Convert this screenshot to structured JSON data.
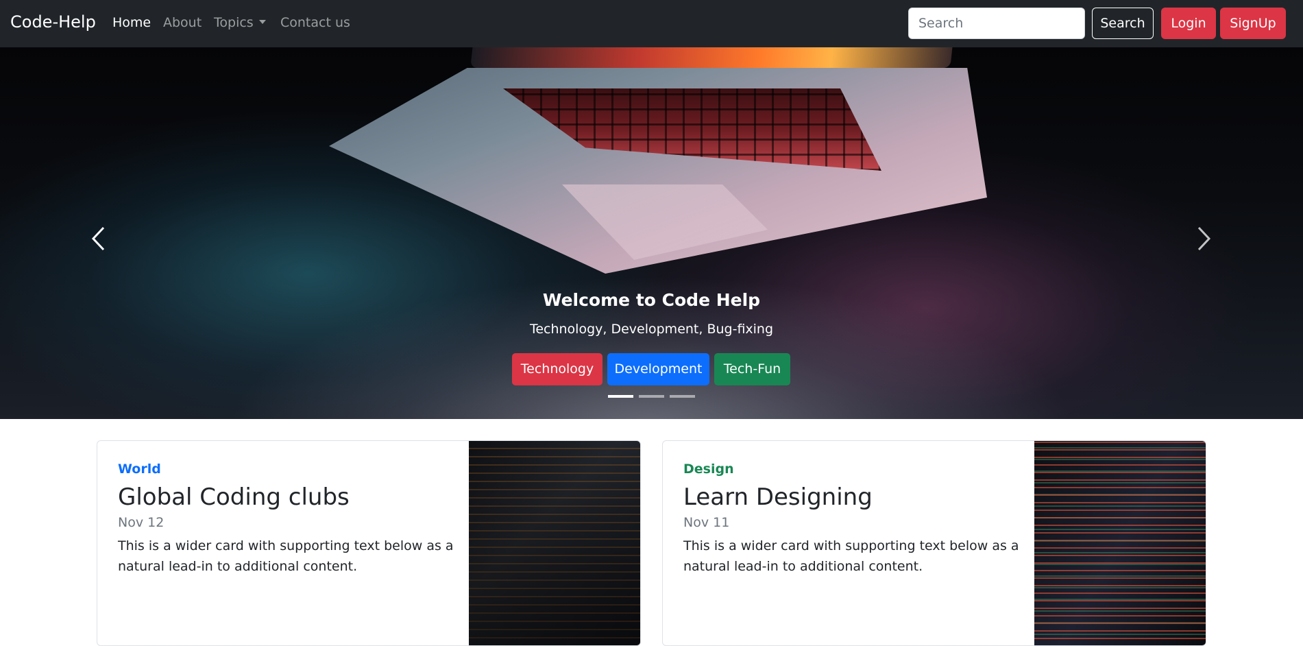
{
  "navbar": {
    "brand": "Code-Help",
    "links": [
      {
        "label": "Home",
        "active": true
      },
      {
        "label": "About",
        "active": false
      },
      {
        "label": "Topics",
        "active": false,
        "dropdown": true
      },
      {
        "label": "Contact us",
        "active": false
      }
    ],
    "search": {
      "placeholder": "Search",
      "value": ""
    },
    "search_button": "Search",
    "login_button": "Login",
    "signup_button": "SignUp"
  },
  "hero": {
    "title": "Welcome to Code Help",
    "subtitle": "Technology, Development, Bug-fixing",
    "buttons": [
      "Technology",
      "Development",
      "Tech-Fun"
    ],
    "active_slide": 1,
    "slide_count": 3
  },
  "cards": [
    {
      "category": "World",
      "title": "Global Coding clubs",
      "date": "Nov 12",
      "text": "This is a wider card with supporting text below as a natural lead-in to additional content."
    },
    {
      "category": "Design",
      "title": "Learn Designing",
      "date": "Nov 11",
      "text": "This is a wider card with supporting text below as a natural lead-in to additional content."
    }
  ],
  "colors": {
    "navbar_bg": "#212529",
    "danger": "#dc3545",
    "primary": "#0d6efd",
    "success": "#198754"
  },
  "icons": {
    "prev": "chevron-left-icon",
    "next": "chevron-right-icon",
    "dropdown": "caret-down-icon"
  }
}
